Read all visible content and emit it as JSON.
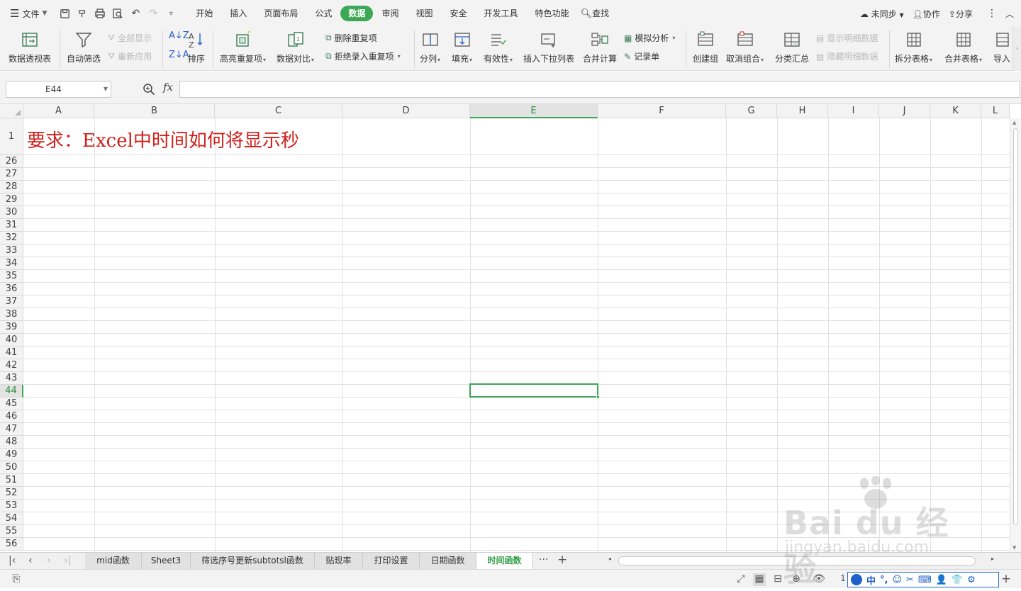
{
  "menubar": {
    "file_label": "文件",
    "tabs": [
      "开始",
      "插入",
      "页面布局",
      "公式",
      "数据",
      "审阅",
      "视图",
      "安全",
      "开发工具",
      "特色功能"
    ],
    "active_tab": "数据",
    "search_label": "查找",
    "sync_label": "未同步",
    "collab_label": "协作",
    "share_label": "分享"
  },
  "ribbon": {
    "pivot": "数据透视表",
    "autofilter": "自动筛选",
    "show_all": "全部显示",
    "reapply": "重新应用",
    "sort": "排序",
    "highlight_dup": "高亮重复项",
    "compare": "数据对比",
    "remove_dup": "删除重复项",
    "reject_dup": "拒绝录入重复项",
    "split": "分列",
    "fill": "填充",
    "validity": "有效性",
    "dropdown": "插入下拉列表",
    "consolidate": "合并计算",
    "whatif": "模拟分析",
    "record": "记录单",
    "create_group": "创建组",
    "ungroup": "取消组合",
    "subtotal": "分类汇总",
    "show_detail": "显示明细数据",
    "hide_detail": "隐藏明细数据",
    "split_table": "拆分表格",
    "merge_table": "合并表格",
    "import": "导入"
  },
  "formulabar": {
    "namebox": "E44",
    "fx": "fx",
    "value": ""
  },
  "grid": {
    "columns": [
      "A",
      "B",
      "C",
      "D",
      "E",
      "F",
      "G",
      "H",
      "I",
      "J",
      "K",
      "L"
    ],
    "selected_column": "E",
    "rows": [
      "1",
      "26",
      "27",
      "28",
      "29",
      "30",
      "31",
      "32",
      "33",
      "34",
      "35",
      "36",
      "37",
      "38",
      "39",
      "40",
      "41",
      "42",
      "43",
      "44",
      "45",
      "46",
      "47",
      "48",
      "49",
      "50",
      "51",
      "52",
      "53",
      "54",
      "55",
      "56"
    ],
    "selected_row": "44",
    "a1_text": "要求：Excel中时间如何将显示秒",
    "a1_color": "#d0211c"
  },
  "sheets": {
    "tabs": [
      "mid函数",
      "Sheet3",
      "筛选序号更新subtotsl函数",
      "贴现率",
      "打印设置",
      "日期函数",
      "时间函数"
    ],
    "active": "时间函数",
    "more": "···",
    "add": "+"
  },
  "status": {
    "zoom_partial": "1",
    "ime": [
      "中",
      "°,",
      "☺",
      "✂",
      "⌨",
      "👤",
      "👕",
      "⚙"
    ]
  },
  "watermark": {
    "brand": "Bai du 经验",
    "url": "jingyan.baidu.com"
  },
  "colors": {
    "accent": "#3aa854",
    "ime": "#1e5fc9"
  }
}
